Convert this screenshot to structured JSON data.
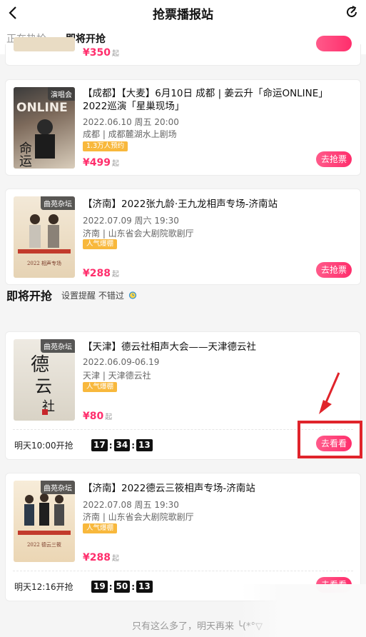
{
  "header": {
    "title": "抢票播报站",
    "back_icon": "chevron-left-icon",
    "refresh_icon": "refresh-icon"
  },
  "tabs": [
    {
      "label": "正在热抢"
    },
    {
      "label": "即将开抢"
    }
  ],
  "top_partial": {
    "price": "¥350",
    "price_suffix": "起"
  },
  "hot_items": [
    {
      "tag": "演唱会",
      "title": "【成都】【大麦】6月10日 成都 | 姜云升「命运ONLINE」2022巡演「星巢现场」",
      "date": "2022.06.10 周五 20:00",
      "venue": "成都 | 成都麓湖水上剧场",
      "badge": "1.3万人预约",
      "price": "¥499",
      "price_suffix": "起",
      "button": "去抢票"
    },
    {
      "tag": "曲苑杂坛",
      "title": "【济南】2022张九龄·王九龙相声专场-济南站",
      "date": "2022.07.09 周六 19:30",
      "venue": "济南 | 山东省会大剧院歌剧厅",
      "badge": "人气爆棚",
      "price": "¥288",
      "price_suffix": "起",
      "button": "去抢票"
    }
  ],
  "upcoming_section": {
    "title": "即将开抢",
    "subtitle": "设置提醒 不错过",
    "alarm_icon": "alarm-clock-icon"
  },
  "upcoming_items": [
    {
      "tag": "曲苑杂坛",
      "title": "【天津】德云社相声大会——天津德云社",
      "date": "2022.06.09-06.19",
      "venue": "天津 | 天津德云社",
      "badge": "人气爆棚",
      "price": "¥80",
      "price_suffix": "起",
      "start": "明天10:00开抢",
      "countdown": [
        "17",
        "34",
        "13"
      ],
      "button": "去看看"
    },
    {
      "tag": "曲苑杂坛",
      "title": "【济南】2022德云三筱相声专场-济南站",
      "date": "2022.07.08 周五 19:30",
      "venue": "济南 | 山东省会大剧院歌剧厅",
      "badge": "人气爆棚",
      "price": "¥288",
      "price_suffix": "起",
      "start": "明天12:16开抢",
      "countdown": [
        "19",
        "50",
        "13"
      ],
      "button": "去看看"
    }
  ],
  "footer": {
    "text": "只有这么多了，明天再来 ╰(*°▽"
  },
  "colors": {
    "accent": "#ff2e6c",
    "badge": "#f8b83c",
    "highlight_box": "#e0242b"
  }
}
